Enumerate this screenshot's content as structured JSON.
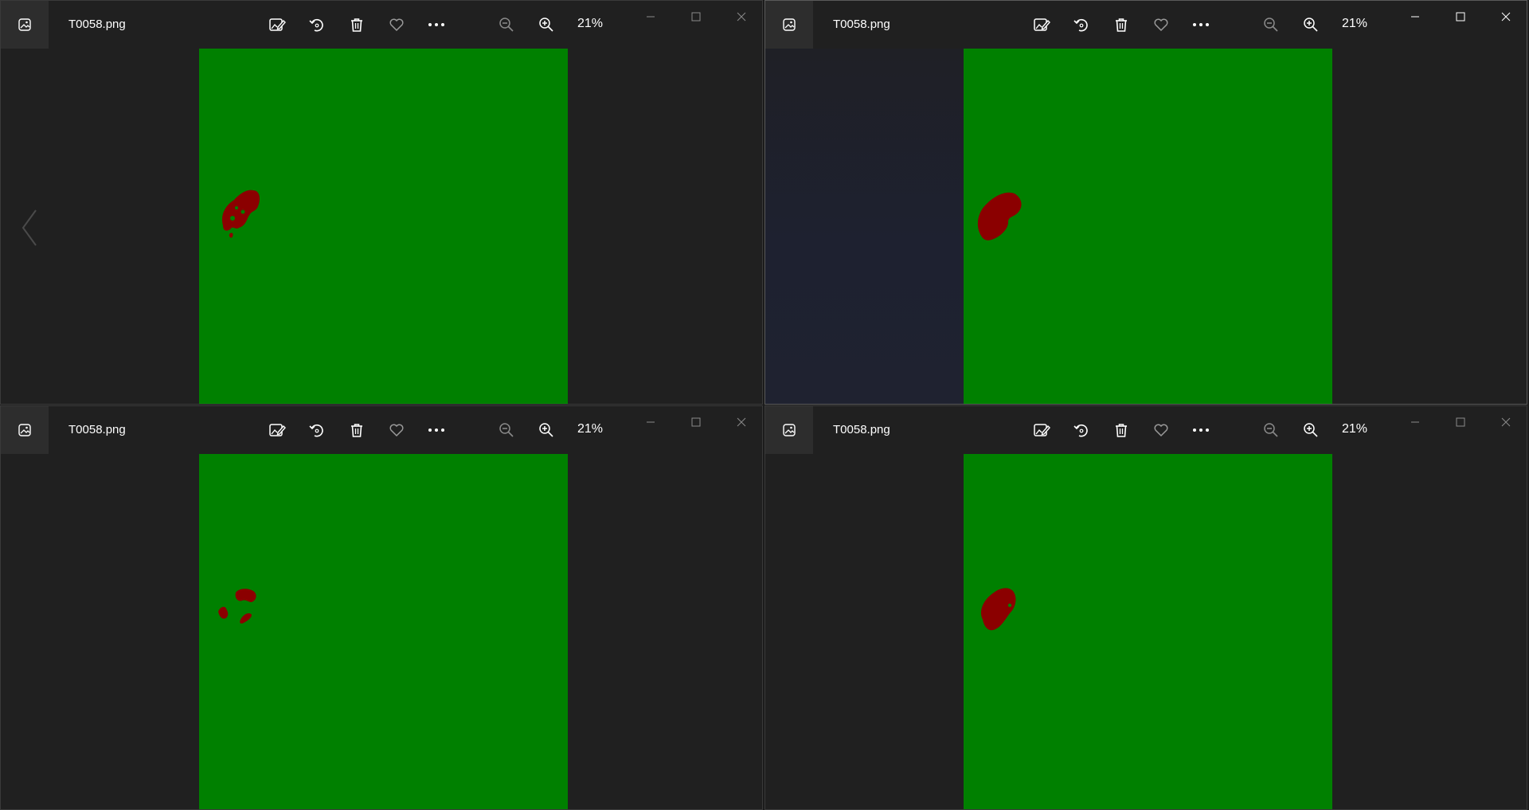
{
  "colors": {
    "window_bg": "#202020",
    "canvas_green": "#008000",
    "region_red": "#8b0000",
    "icon_active": "#ffffff",
    "icon_dim": "#8a8a8a"
  },
  "icons": {
    "app": "photos-app-icon",
    "edit": "edit-image-icon",
    "rotate": "rotate-icon",
    "delete": "trash-icon",
    "favorite": "heart-icon",
    "more": "more-dots-icon",
    "zoom_out": "zoom-out-icon",
    "zoom_in": "zoom-in-icon",
    "minimize": "minimize-icon",
    "maximize": "maximize-icon",
    "close": "close-icon",
    "previous": "chevron-left-icon"
  },
  "windows": [
    {
      "filename": "T0058.png",
      "zoom": "21%"
    },
    {
      "filename": "T0058.png",
      "zoom": "21%"
    },
    {
      "filename": "T0058.png",
      "zoom": "21%"
    },
    {
      "filename": "T0058.png",
      "zoom": "21%"
    }
  ]
}
